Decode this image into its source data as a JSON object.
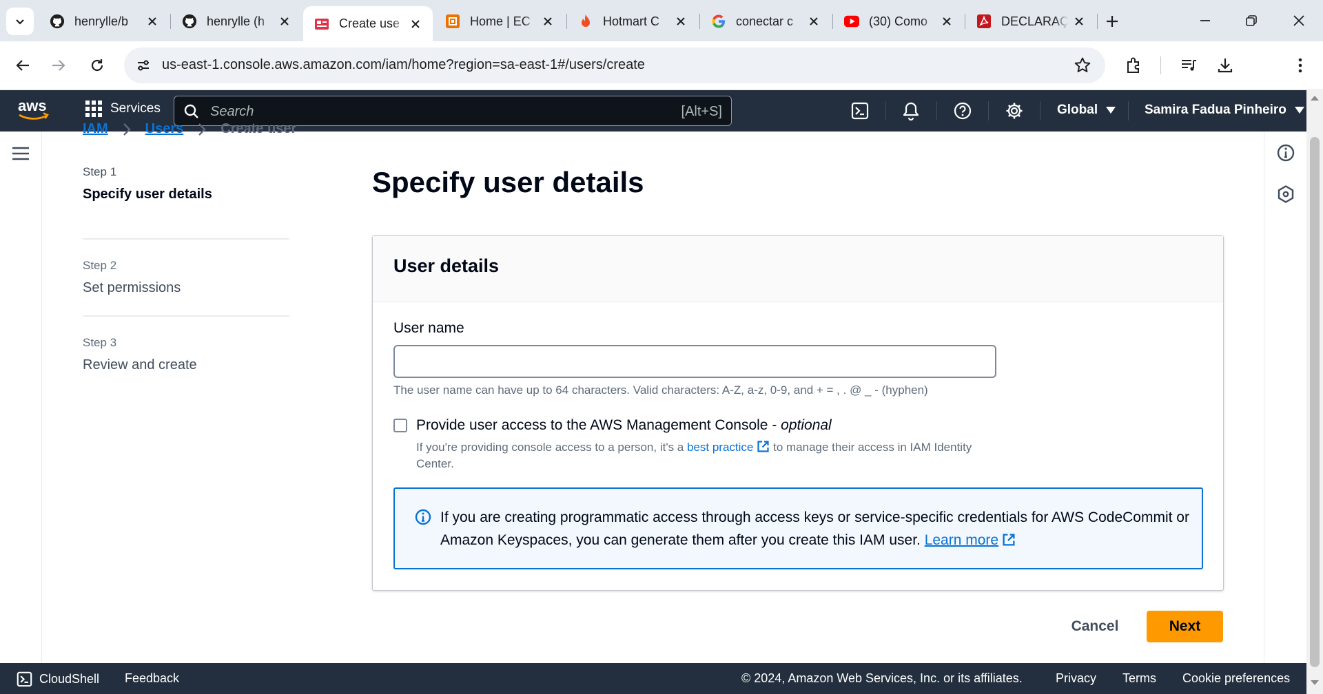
{
  "browser": {
    "tabs": [
      {
        "title": "henrylle/b",
        "icon": "github-icon",
        "active": false
      },
      {
        "title": "henrylle (h",
        "icon": "github-icon",
        "active": false
      },
      {
        "title": "Create use",
        "icon": "aws-console-icon",
        "active": true
      },
      {
        "title": "Home | EC",
        "icon": "aws-ec2-icon",
        "active": false
      },
      {
        "title": "Hotmart C",
        "icon": "hotmart-icon",
        "active": false
      },
      {
        "title": "conectar c",
        "icon": "google-icon",
        "active": false
      },
      {
        "title": "(30) Como",
        "icon": "youtube-icon",
        "active": false
      },
      {
        "title": "DECLARAÇ",
        "icon": "pdf-icon",
        "active": false
      }
    ],
    "url": "us-east-1.console.aws.amazon.com/iam/home?region=sa-east-1#/users/create"
  },
  "aws_header": {
    "logo_text": "aws",
    "services_label": "Services",
    "search_placeholder": "Search",
    "search_shortcut": "[Alt+S]",
    "region": "Global",
    "account": "Samira Fadua Pinheiro"
  },
  "breadcrumb": {
    "items": [
      "IAM",
      "Users"
    ],
    "current": "Create user"
  },
  "wizard": {
    "steps": [
      {
        "number": "Step 1",
        "name": "Specify user details",
        "active": true
      },
      {
        "number": "Step 2",
        "name": "Set permissions",
        "active": false
      },
      {
        "number": "Step 3",
        "name": "Review and create",
        "active": false
      }
    ]
  },
  "page": {
    "title": "Specify user details",
    "panel_title": "User details",
    "username_label": "User name",
    "username_value": "",
    "username_hint": "The user name can have up to 64 characters. Valid characters: A-Z, a-z, 0-9, and + = , . @ _ - (hyphen)",
    "console_access_label": "Provide user access to the AWS Management Console - ",
    "console_access_optional": "optional",
    "console_access_checked": false,
    "console_access_desc_prefix": "If you're providing console access to a person, it's a ",
    "console_access_desc_link": "best practice",
    "console_access_desc_suffix": " to manage their access in IAM Identity Center.",
    "info_alert_text": "If you are creating programmatic access through access keys or service-specific credentials for AWS CodeCommit or Amazon Keyspaces, you can generate them after you create this IAM user. ",
    "info_alert_link": "Learn more",
    "cancel_label": "Cancel",
    "next_label": "Next"
  },
  "footer": {
    "cloudshell": "CloudShell",
    "feedback": "Feedback",
    "copyright": "© 2024, Amazon Web Services, Inc. or its affiliates.",
    "privacy": "Privacy",
    "terms": "Terms",
    "cookies": "Cookie preferences"
  },
  "colors": {
    "aws_nav": "#232f3e",
    "link": "#0972d3",
    "primary_button": "#ff9900",
    "info_bg": "#f2f8fd"
  }
}
